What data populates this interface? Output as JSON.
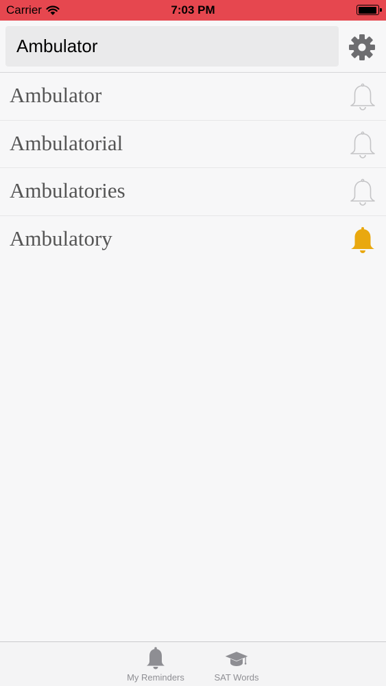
{
  "status_bar": {
    "carrier": "Carrier",
    "time": "7:03 PM"
  },
  "search": {
    "value": "Ambulator"
  },
  "words": [
    {
      "text": "Ambulator",
      "reminder_set": false
    },
    {
      "text": "Ambulatorial",
      "reminder_set": false
    },
    {
      "text": "Ambulatories",
      "reminder_set": false
    },
    {
      "text": "Ambulatory",
      "reminder_set": true
    }
  ],
  "tabs": [
    {
      "label": "My Reminders",
      "icon": "bell-icon"
    },
    {
      "label": "SAT Words",
      "icon": "graduation-cap-icon"
    }
  ],
  "colors": {
    "status_bar": "#e6474f",
    "bell_active": "#e9a80f",
    "bell_inactive": "#c4c4c6",
    "gear": "#6d6d70",
    "tab_inactive": "#8e8e93"
  }
}
